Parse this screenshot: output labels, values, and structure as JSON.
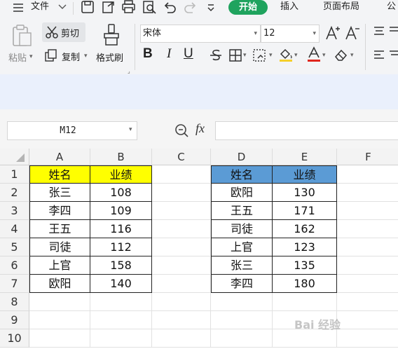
{
  "menu": {
    "file_label": "文件",
    "tabs": [
      "开始",
      "插入",
      "页面布局",
      "公"
    ]
  },
  "ribbon": {
    "paste_label": "粘贴",
    "cut_label": "剪切",
    "copy_label": "复制",
    "format_painter_label": "格式刷",
    "font_name": "宋体",
    "font_size": "12",
    "bold": "B",
    "italic": "I",
    "underline": "U"
  },
  "formula_bar": {
    "name_box": "M12",
    "fx_label": "fx",
    "formula": ""
  },
  "sheet": {
    "columns": [
      "A",
      "B",
      "C",
      "D",
      "E",
      "F"
    ],
    "rows": [
      "1",
      "2",
      "3",
      "4",
      "5",
      "6",
      "7",
      "8",
      "9",
      "10"
    ],
    "table1": {
      "header": [
        "姓名",
        "业绩"
      ],
      "rows": [
        [
          "张三",
          "108"
        ],
        [
          "李四",
          "109"
        ],
        [
          "王五",
          "116"
        ],
        [
          "司徒",
          "112"
        ],
        [
          "上官",
          "158"
        ],
        [
          "欧阳",
          "140"
        ]
      ]
    },
    "table2": {
      "header": [
        "姓名",
        "业绩"
      ],
      "rows": [
        [
          "欧阳",
          "130"
        ],
        [
          "王五",
          "171"
        ],
        [
          "司徒",
          "162"
        ],
        [
          "上官",
          "123"
        ],
        [
          "张三",
          "135"
        ],
        [
          "李四",
          "180"
        ]
      ]
    }
  },
  "colors": {
    "start_tab": "#1fa35e",
    "header1_fill": "#ffff00",
    "header2_fill": "#5b9bd5",
    "font_color_bar": "#e0261d"
  },
  "watermark": "Bai 经验"
}
